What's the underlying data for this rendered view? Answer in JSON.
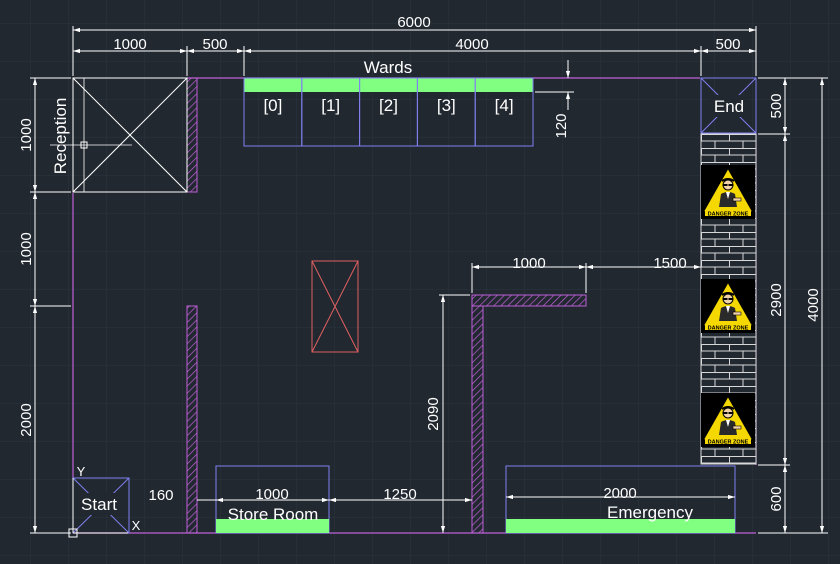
{
  "colors": {
    "background": "#212830",
    "grid": "#2c343e",
    "dimension": "#ffffff",
    "wall": "#c060d8",
    "outline": "#8080f0",
    "green": "#80ff80",
    "danger_box": "#e06060",
    "danger_yellow": "#f5d800",
    "brick": "#d8d8d8"
  },
  "dimensions": {
    "top_total": "6000",
    "top_seg_1": "1000",
    "top_seg_2": "500",
    "top_seg_3": "4000",
    "top_seg_4": "500",
    "left_1": "1000",
    "left_2": "1000",
    "left_3": "2000",
    "right_1": "500",
    "right_2": "2900",
    "right_3": "600",
    "right_total": "4000",
    "ward_height": "120",
    "corridor_1": "1000",
    "corridor_2": "1500",
    "mid_wall_height": "2090",
    "bottom_gap": "160",
    "store_width": "1000",
    "gap_width": "1250",
    "emergency_width": "2000"
  },
  "rooms": {
    "reception": "Reception",
    "wards": "Wards",
    "ward_beds": [
      "[0]",
      "[1]",
      "[2]",
      "[3]",
      "[4]"
    ],
    "end": "End",
    "start": "Start",
    "store_room": "Store Room",
    "emergency": "Emergency"
  },
  "axes": {
    "y": "Y",
    "x": "X"
  },
  "danger_sign": {
    "label": "DANGER ZONE",
    "count": 3
  }
}
